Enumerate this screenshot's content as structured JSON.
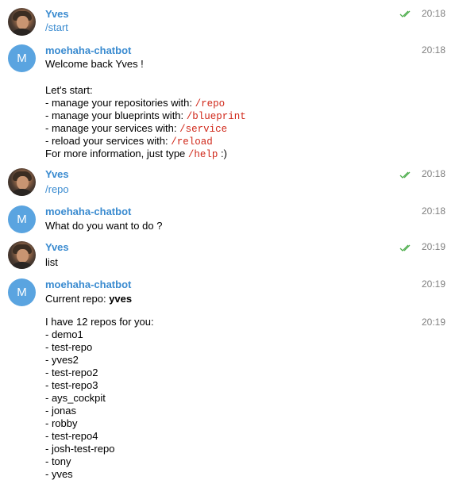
{
  "messages": [
    {
      "sender": "Yves",
      "time": "20:18",
      "text": "/start"
    },
    {
      "sender": "moehaha-chatbot",
      "avatar_letter": "M",
      "time": "20:18",
      "lines": [
        {
          "text": "Welcome back Yves !"
        },
        {
          "text": "Let's start:"
        },
        {
          "text": " - manage your repositories with: ",
          "cmd": "/repo"
        },
        {
          "text": " - manage your blueprints with: ",
          "cmd": "/blueprint"
        },
        {
          "text": " - manage your services with: ",
          "cmd": "/service"
        },
        {
          "text": " - reload your services with: ",
          "cmd": "/reload"
        },
        {
          "text": "For more information, just type ",
          "cmd": "/help",
          "after": " :)"
        }
      ]
    },
    {
      "sender": "Yves",
      "time": "20:18",
      "text": "/repo"
    },
    {
      "sender": "moehaha-chatbot",
      "avatar_letter": "M",
      "time": "20:18",
      "text": "What do you want to do ?"
    },
    {
      "sender": "Yves",
      "time": "20:19",
      "text": "list"
    },
    {
      "sender": "moehaha-chatbot",
      "avatar_letter": "M",
      "time": "20:19",
      "current_repo_label": "Current repo: ",
      "current_repo": "yves"
    },
    {
      "time": "20:19",
      "intro": "I have 12 repos for you:",
      "repos": [
        "- demo1",
        "- test-repo",
        "- yves2",
        "- test-repo2",
        "- test-repo3",
        "- ays_cockpit",
        "- jonas",
        "- robby",
        "- test-repo4",
        "- josh-test-repo",
        "- tony",
        "- yves"
      ]
    }
  ],
  "colors": {
    "sender_name": "#3a8bd0",
    "command": "#d0281a",
    "read_check": "#4fae4e",
    "avatar_bot": "#5aa4e0",
    "timestamp": "#7f7f7f"
  },
  "icons": {
    "read_receipt": "double-check-icon"
  }
}
